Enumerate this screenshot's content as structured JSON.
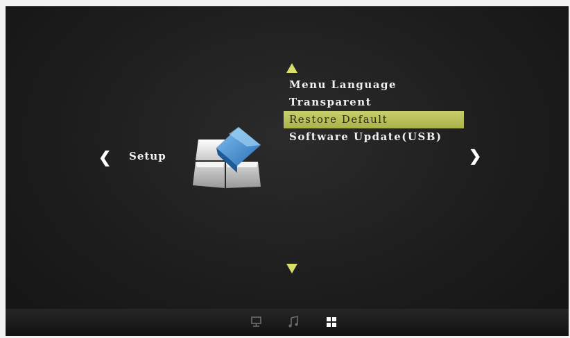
{
  "page": {
    "title": "Setup"
  },
  "menu": {
    "items": [
      {
        "label": "Menu Language"
      },
      {
        "label": "Transparent"
      },
      {
        "label": "Restore Default",
        "selected": true
      },
      {
        "label": "Software Update(USB)"
      }
    ]
  },
  "nav": {
    "left_glyph": "❮",
    "right_glyph": "❯"
  },
  "bottom_bar": {
    "icons": [
      "monitor-icon",
      "music-note-icon",
      "grid-icon"
    ],
    "active": "grid-icon"
  },
  "colors": {
    "highlight": "#c2c860",
    "arrow": "#d7de6a",
    "background": "#1d1d1d",
    "text": "#f0f0f0",
    "icon_blue": "#4a90d9"
  }
}
